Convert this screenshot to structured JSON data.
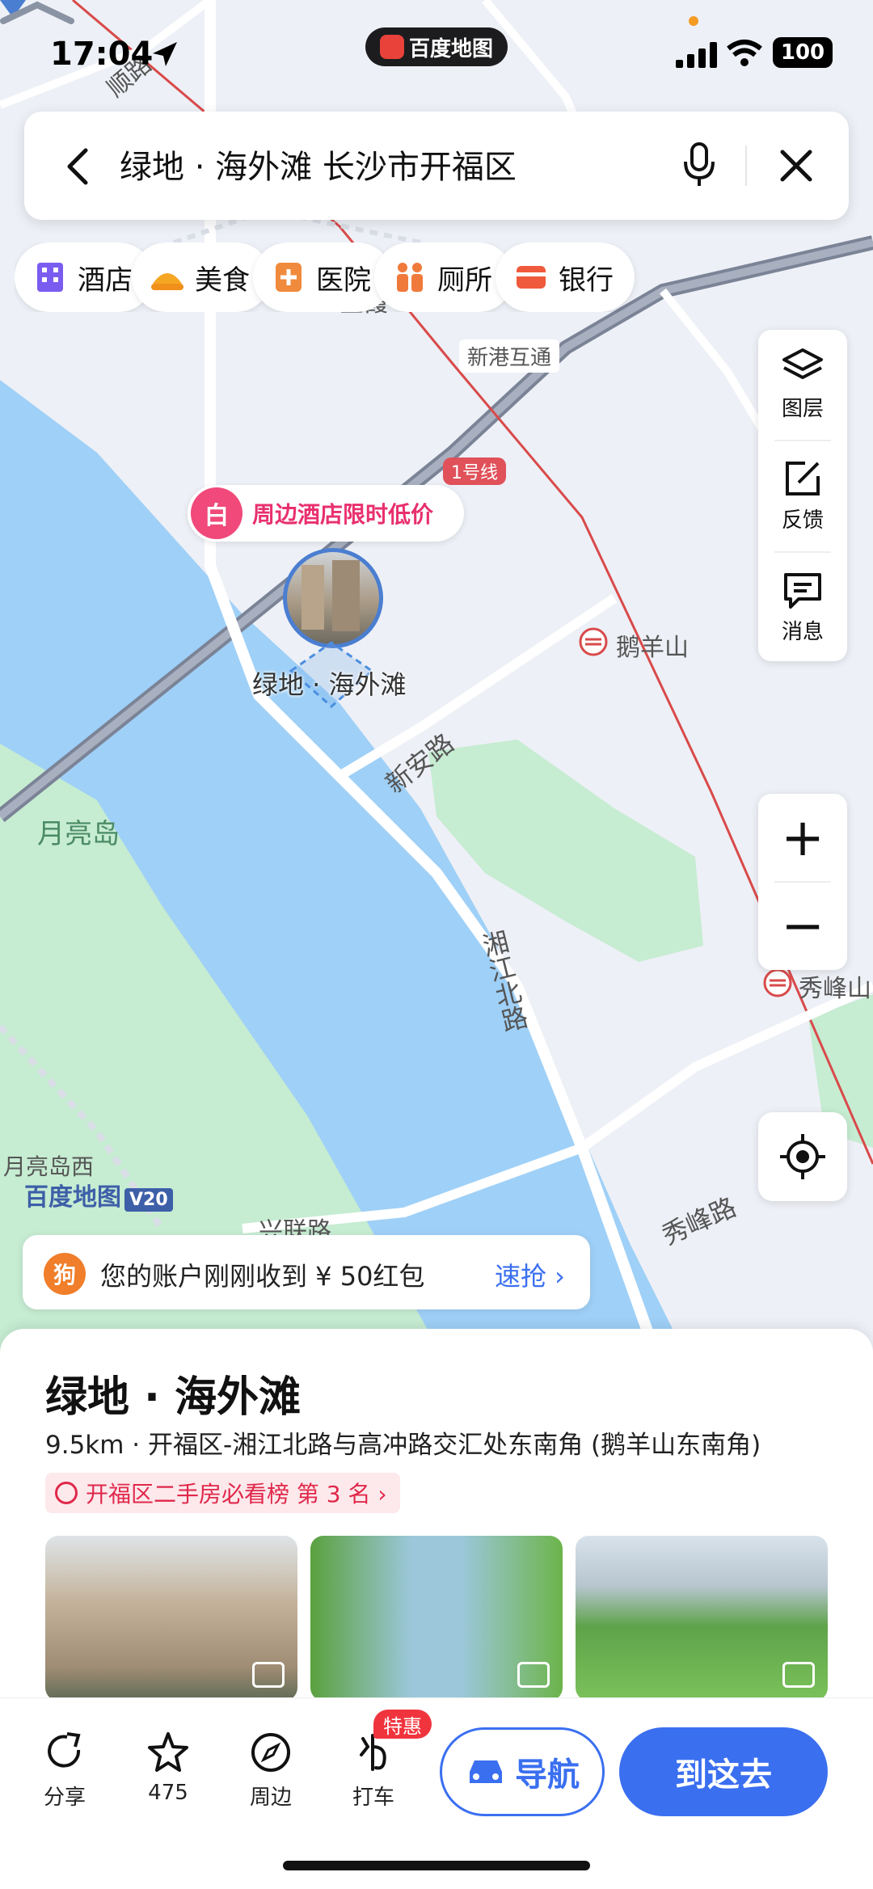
{
  "status_bar": {
    "time": "17:04",
    "app_pill": "百度地图",
    "battery": "100"
  },
  "search": {
    "query": "绿地 · 海外滩 长沙市开福区"
  },
  "categories": [
    {
      "label": "酒店",
      "icon": "hotel-icon",
      "color": "#7b5cf0"
    },
    {
      "label": "美食",
      "icon": "food-icon",
      "color": "#f5a623"
    },
    {
      "label": "医院",
      "icon": "hospital-icon",
      "color": "#f08a3c"
    },
    {
      "label": "厕所",
      "icon": "toilet-icon",
      "color": "#f07a3c"
    },
    {
      "label": "银行",
      "icon": "bank-icon",
      "color": "#f05a3c"
    }
  ],
  "right_panel": {
    "layers": "图层",
    "feedback": "反馈",
    "messages": "消息"
  },
  "zoom": {
    "in": "+",
    "out": "−"
  },
  "map_labels": {
    "road_top": "顺路",
    "gold_label": "金霞",
    "interchange": "新港互通",
    "line1": "1号线",
    "eyangshan": "鹅羊山",
    "xinan_road": "新安路",
    "yueliang_island": "月亮岛",
    "xiangjiang_north": "湘江北路",
    "xiufengshan": "秀峰山",
    "yueliang_west": "月亮岛西",
    "xiufeng_road": "秀峰路",
    "xinglian_road": "兴联路"
  },
  "hotel_promo": {
    "badge": "白",
    "text": "周边酒店限时低价"
  },
  "poi_map_name": "绿地 · 海外滩",
  "brand": {
    "name": "百度地图",
    "version": "V20"
  },
  "red_packet": {
    "icon_text": "狗",
    "text": "您的账户刚刚收到 ¥ 50红包",
    "action": "速抢 ›"
  },
  "place": {
    "title": "绿地 · 海外滩",
    "address": "9.5km · 开福区-湘江北路与高冲路交汇处东南角 (鹅羊山东南角)",
    "rank": "开福区二手房必看榜 第 3 名  ›"
  },
  "toolbar": {
    "share": "分享",
    "favorite_count": "475",
    "nearby": "周边",
    "taxi": "打车",
    "taxi_badge": "特惠",
    "navigate": "导航",
    "go_here": "到这去"
  },
  "colors": {
    "accent": "#3a6ff0",
    "river": "#9fd0f7",
    "park": "#bfeacb",
    "promo": "#e8306f"
  }
}
